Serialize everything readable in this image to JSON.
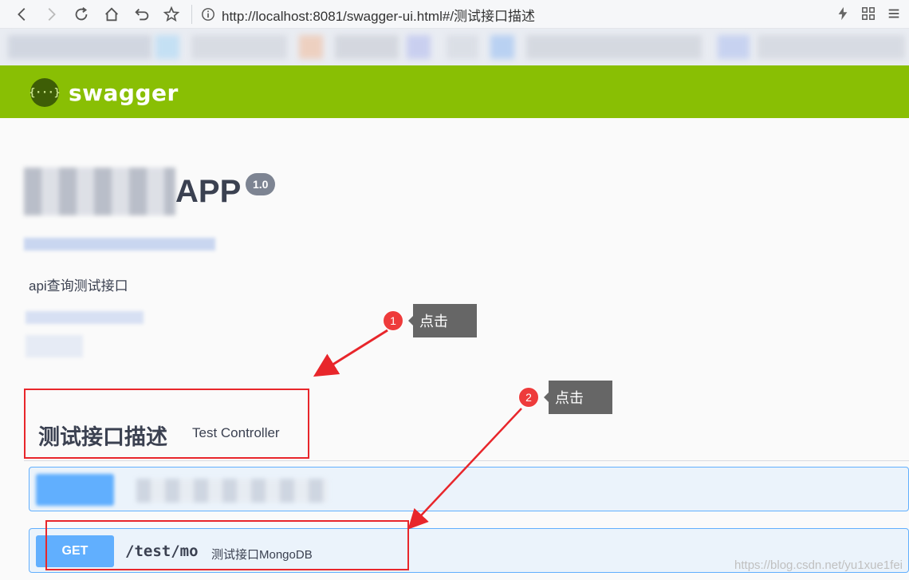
{
  "browser": {
    "url": "http://localhost:8081/swagger-ui.html#/测试接口描述"
  },
  "header": {
    "logo_text": "{···}",
    "brand": "swagger"
  },
  "info": {
    "title_visible": "APP",
    "version": "1.0",
    "description": "api查询测试接口"
  },
  "tag": {
    "name": "测试接口描述",
    "description": "Test Controller"
  },
  "operations": [
    {
      "method": "",
      "path": "",
      "summary": ""
    },
    {
      "method": "GET",
      "path": "/test/mo",
      "summary": "测试接口MongoDB"
    }
  ],
  "annotations": {
    "step1_number": "1",
    "step1_text": "点击",
    "step2_number": "2",
    "step2_text": "点击",
    "colors": {
      "red": "#e8262b",
      "tooltip": "#666666"
    }
  },
  "watermark": "https://blog.csdn.net/yu1xue1fei",
  "colors": {
    "swagger_green": "#89bf04",
    "get_blue": "#61affe"
  }
}
